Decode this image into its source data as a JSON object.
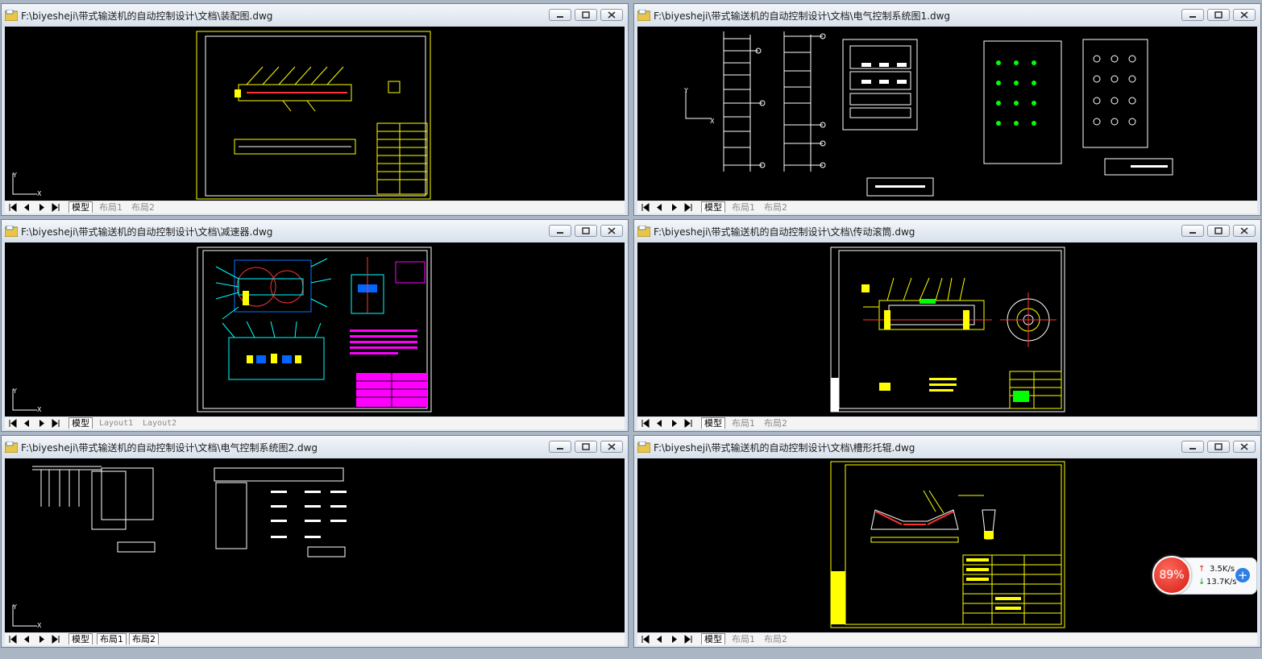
{
  "windows": [
    {
      "title": "F:\\biyesheji\\带式输送机的自动控制设计\\文档\\装配图.dwg",
      "tabs": [
        "模型",
        "布局1",
        "布局2"
      ]
    },
    {
      "title": "F:\\biyesheji\\带式输送机的自动控制设计\\文档\\电气控制系统图1.dwg",
      "tabs": [
        "模型",
        "布局1",
        "布局2"
      ]
    },
    {
      "title": "F:\\biyesheji\\带式输送机的自动控制设计\\文档\\减速器.dwg",
      "tabs": [
        "模型",
        "Layout1",
        "Layout2"
      ]
    },
    {
      "title": "F:\\biyesheji\\带式输送机的自动控制设计\\文档\\传动滚筒.dwg",
      "tabs": [
        "模型",
        "布局1",
        "布局2"
      ]
    },
    {
      "title": "F:\\biyesheji\\带式输送机的自动控制设计\\文档\\电气控制系统图2.dwg",
      "tabs": [
        "模型",
        "布局1",
        "布局2"
      ]
    },
    {
      "title": "F:\\biyesheji\\带式输送机的自动控制设计\\文档\\槽形托辊.dwg",
      "tabs": [
        "模型",
        "布局1",
        "布局2"
      ]
    }
  ],
  "ucs": {
    "x": "X",
    "y": "Y"
  },
  "network_widget": {
    "percent": "89%",
    "upload": "3.5K/s",
    "download": "13.7K/s",
    "plus": "+"
  },
  "colors": {
    "canvas": "#000000",
    "yellow": "#ffff00",
    "cyan": "#00ffff",
    "magenta": "#ff00ff",
    "white": "#ffffff",
    "red": "#ff0000"
  },
  "icons": {
    "title": "dwg-file-icon",
    "minimize": "minimize-icon",
    "restore": "restore-icon",
    "close": "close-icon"
  }
}
